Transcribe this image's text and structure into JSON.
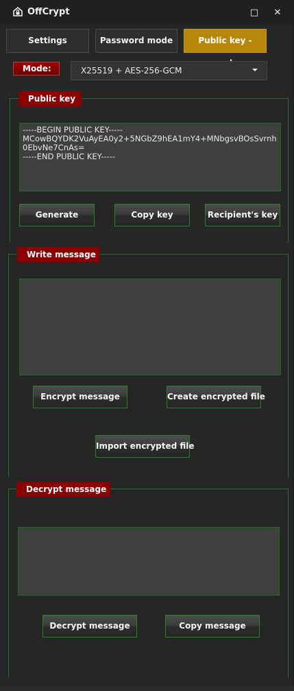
{
  "app": {
    "title": "OffCrypt",
    "icon": "home-lock-icon",
    "minimize_glyph": "□",
    "close_glyph": "✕"
  },
  "tabs": [
    {
      "label": "Settings",
      "active": false
    },
    {
      "label": "Password mode",
      "active": false
    },
    {
      "label": "Public key - mode",
      "active": true
    }
  ],
  "mode": {
    "label": "Mode:",
    "selected": "X25519 + AES-256-GCM"
  },
  "public_key": {
    "title": "Public key",
    "text": "-----BEGIN PUBLIC KEY-----\nMCowBQYDK2VuAyEA0y2+5NGbZ9hEA1mY4+MNbgsvBOsSvrnh0EbvNe7CnAs=\n-----END PUBLIC KEY-----",
    "buttons": {
      "generate": "Generate",
      "copy": "Copy key",
      "recipient": "Recipient's key"
    }
  },
  "write_message": {
    "title": "Write message",
    "text": "",
    "buttons": {
      "encrypt": "Encrypt message",
      "create_file": "Create encrypted file",
      "import_file": "Import encrypted file"
    }
  },
  "decrypt_message": {
    "title": "Decrypt message",
    "text": "",
    "buttons": {
      "decrypt": "Decrypt message",
      "copy": "Copy message"
    }
  },
  "colors": {
    "active_tab": "#b8860b",
    "label_red": "#8b0000",
    "border_green": "#2e7d2e"
  }
}
